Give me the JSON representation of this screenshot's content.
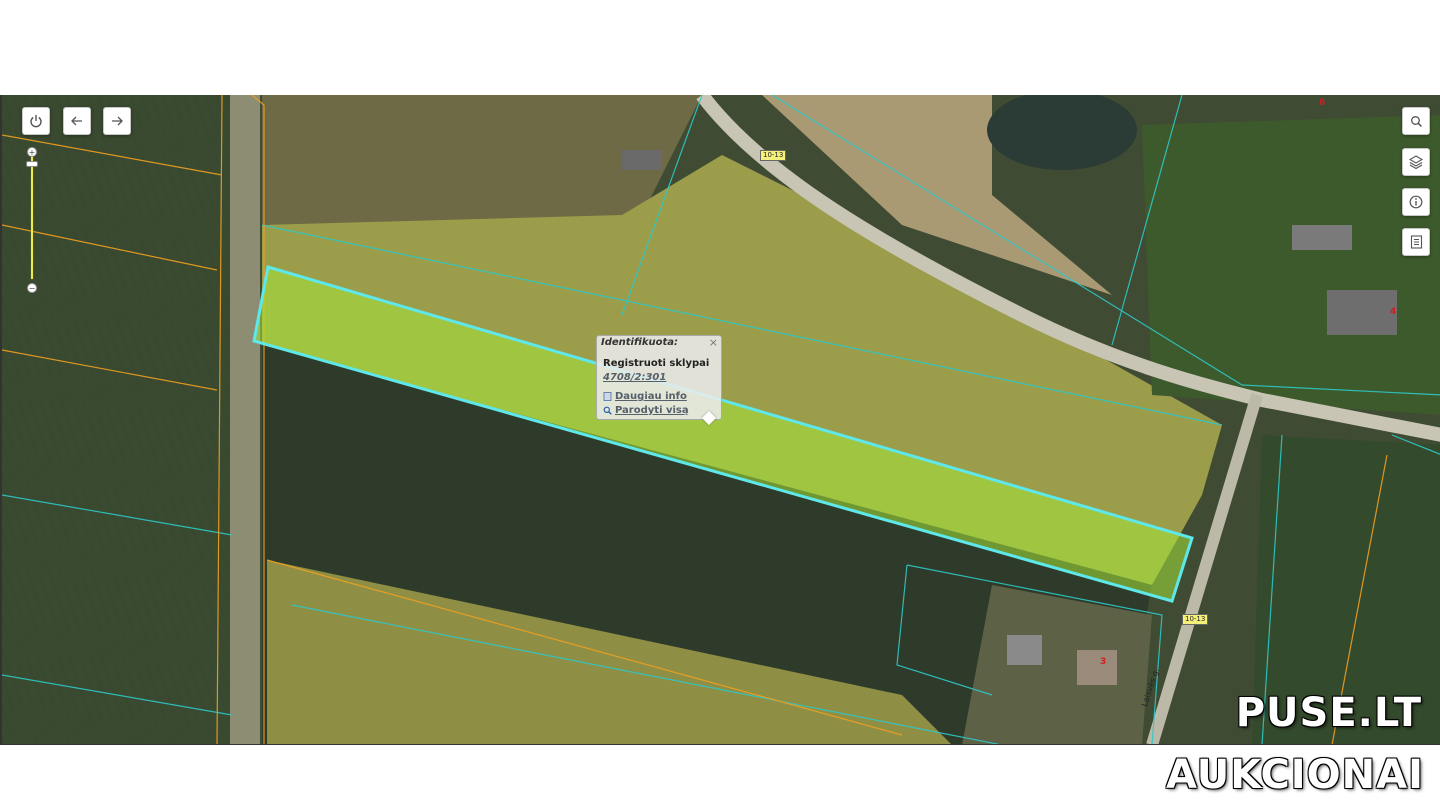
{
  "map": {
    "popup": {
      "title": "Identifikuota:",
      "close": "×",
      "subtitle": "Registruoti sklypai",
      "parcel_id": "4708/2:301",
      "more_info": "Daugiau info",
      "show_all": "Parodyti visą"
    },
    "road_labels": [
      "10-13",
      "10-13"
    ],
    "street_label": "Laisvės g.",
    "lot_numbers": [
      "6",
      "4",
      "3"
    ],
    "highlight_color": "#5ee8ea",
    "parcel_fill": "#a4e63a",
    "cadastre_line_color": "#2ec8c8",
    "boundary_line_color": "#f0a020"
  },
  "controls": {
    "power": "power-icon",
    "back": "arrow-left-icon",
    "forward": "arrow-right-icon",
    "zoom_plus": "+",
    "zoom_minus": "−",
    "right_tools": [
      "search-icon",
      "layers-icon",
      "info-icon",
      "document-icon"
    ]
  },
  "watermark": {
    "line1": "PUSE.LT",
    "line2": "AUKCIONAI"
  }
}
